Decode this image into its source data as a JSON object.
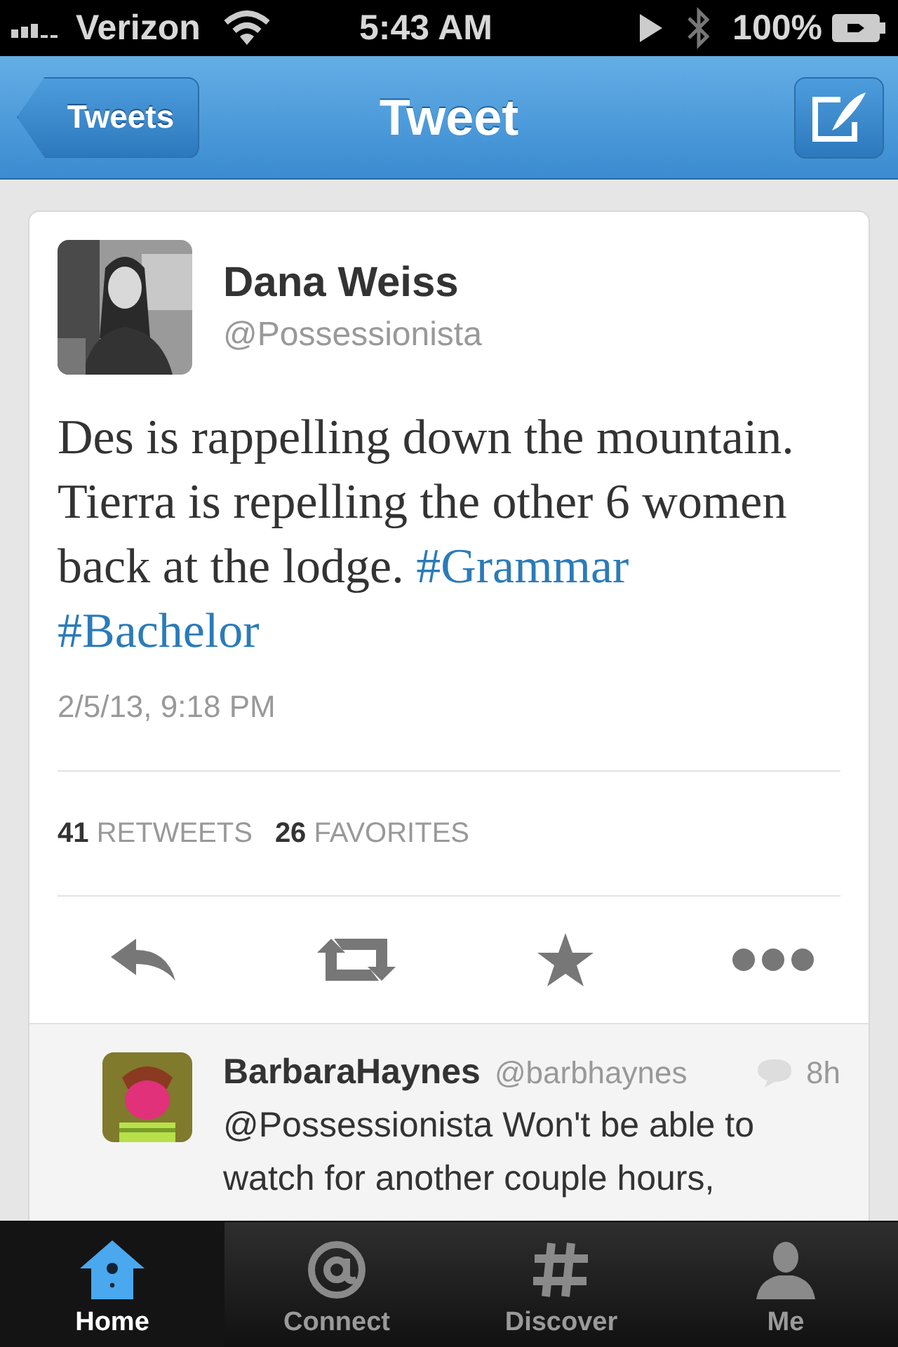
{
  "status_bar": {
    "carrier": "Verizon",
    "time": "5:43 AM",
    "battery": "100%"
  },
  "nav": {
    "back": "Tweets",
    "title": "Tweet"
  },
  "tweet": {
    "name": "Dana Weiss",
    "handle": "@Possessionista",
    "text": "Des is rappelling down the mountain. Tierra is repelling the other 6 women back at the lodge.",
    "hashtags": [
      "#Grammar",
      "#Bachelor"
    ],
    "date": "2/5/13, 9:18 PM",
    "stats": [
      {
        "count": "41",
        "label": "RETWEETS"
      },
      {
        "count": "26",
        "label": "FAVORITES"
      }
    ]
  },
  "reply": {
    "name": "BarbaraHaynes",
    "handle": "@barbhaynes",
    "time": "8h",
    "text": "@Possessionista Won't be able to watch for another couple hours,"
  },
  "tabs": [
    {
      "label": "Home",
      "selected": true
    },
    {
      "label": "Connect",
      "selected": false
    },
    {
      "label": "Discover",
      "selected": false
    },
    {
      "label": "Me",
      "selected": false
    }
  ]
}
